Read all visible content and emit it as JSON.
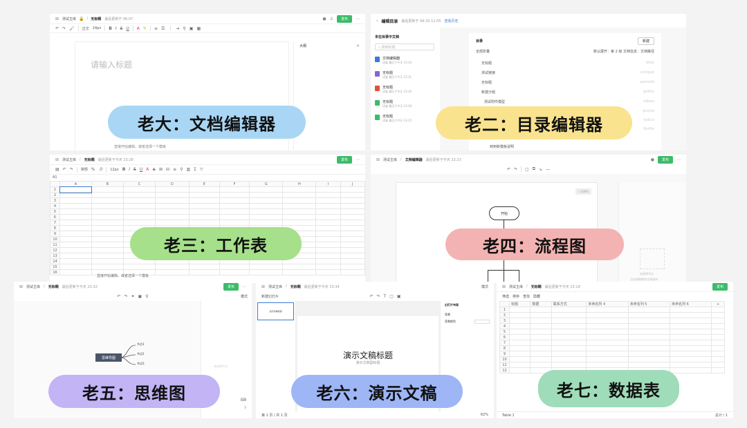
{
  "panels": {
    "doc": {
      "crumb_home": "测试主库",
      "crumb_doc": "无标题",
      "saved": "最后更新于 06:07",
      "publish": "发布",
      "format_items": [
        "正文",
        "14px"
      ],
      "title_placeholder": "请输入标题",
      "outline_label": "大纲",
      "body_hint": "直接开始编辑，或者选择一个模板",
      "label": "老大：文档编辑器"
    },
    "toc": {
      "title": "编辑目录",
      "saved": "最后更新于 06-30 11:05",
      "history": "查看历史",
      "side_title": "未在目录中文档",
      "search_placeholder": "搜索标题",
      "side_items": [
        {
          "name": "文档编辑器",
          "meta": "语雀 最后于今天 23:34"
        },
        {
          "name": "无标题",
          "meta": "语雀 最后于今天 23:31"
        },
        {
          "name": "无标题",
          "meta": "语雀 最后于今天 23:30"
        },
        {
          "name": "无标题",
          "meta": "语雀 最后于今天 23:28"
        },
        {
          "name": "无标题",
          "meta": "语雀 最后于今天 23:25"
        }
      ],
      "dir_label": "目录",
      "new_button": "新建",
      "collapse_all": "全部折叠",
      "expand_default": "默认展开：第 2 级",
      "doc_info": "文档信息：文档路径",
      "rows": [
        {
          "name": "无标题",
          "path": "bkbk"
        },
        {
          "name": "测试链接",
          "path": "yxmgyb"
        },
        {
          "name": "无标题",
          "path": "pqxmbb"
        },
        {
          "name": "新建分组",
          "path": "gkdfzs"
        },
        {
          "name": "测试附件模型",
          "path": "xdbwx"
        },
        {
          "name": "",
          "path": "gnsytd"
        },
        {
          "name": "",
          "path": "wzbca"
        },
        {
          "name": "",
          "path": "fbxfhx"
        }
      ],
      "footer_link": "到到新模板说明",
      "label": "老二：目录编辑器"
    },
    "sheet": {
      "crumb_home": "测试主库",
      "crumb_doc": "无标题",
      "saved": "最后更新于今天 23:28",
      "publish": "发布",
      "font": "常规",
      "size": "12px",
      "cell_ref": "A1",
      "cols": [
        "A",
        "B",
        "C",
        "D",
        "E",
        "F",
        "G",
        "H",
        "I",
        "J"
      ],
      "rows": [
        "1",
        "2",
        "3",
        "4",
        "5",
        "6",
        "7",
        "8",
        "9",
        "10",
        "11",
        "12",
        "13",
        "14",
        "15",
        "16"
      ],
      "hint": "直接开始编辑，或者选择一个模板",
      "label": "老三：工作表"
    },
    "flow": {
      "crumb_home": "测试主库",
      "crumb_doc": "文档编辑器",
      "saved": "最后更新于今天 23:23",
      "publish": "发布",
      "start_node": "开始",
      "canvas_hint": "未选择节点",
      "side_hint": "点击或拖拽节点到画布",
      "label": "老四：流程图"
    },
    "mind": {
      "crumb_home": "测试主库",
      "crumb_doc": "无标题",
      "saved": "最后更新于今天 23:32",
      "publish": "发布",
      "mode": "模式",
      "root": "思维导图",
      "nodes": [
        "节点1",
        "节点2",
        "节点3"
      ],
      "side_hint": "未选择节点",
      "label": "老五：思维图"
    },
    "ppt": {
      "crumb_home": "测试主库",
      "crumb_doc": "无标题",
      "saved": "最后更新于今天 23:34",
      "new_slide": "新建幻灯片",
      "slide_title": "演示文稿标题",
      "slide_subtitle": "演示文稿副标题",
      "panel_title": "幻灯片布局",
      "bg": "背景",
      "bg_color": "背景颜色",
      "footer": "第 1 页 / 共 1 页",
      "zoom": "62%",
      "mode": "模式",
      "label": "老六：演示文稿"
    },
    "table": {
      "crumb_home": "测试主库",
      "crumb_doc": "无标题",
      "saved": "最后更新于今天 23:18",
      "publish": "发布",
      "tools": [
        "筛选",
        "排序",
        "查找",
        "隐藏"
      ],
      "headers": [
        "标题",
        "数据",
        "联系方式",
        "未命名列 4",
        "未命名列 5",
        "未命名列 6"
      ],
      "rows": [
        "1",
        "2",
        "3",
        "4",
        "5",
        "6",
        "7",
        "8",
        "9",
        "10",
        "11",
        "12"
      ],
      "sheet_tab": "Table 1",
      "footer_count": "总计 / 1",
      "label": "老七：数据表"
    }
  },
  "colors": {
    "blue_pill": "#a9d6f5",
    "yellow_pill": "#f9e38f",
    "green_pill": "#a6e08a",
    "red_pill": "#f4b3b3",
    "purple_pill": "#c2b4f5",
    "indigo_pill": "#9eb6f5",
    "teal_pill": "#9fdcba",
    "publish": "#3dbb6b"
  }
}
